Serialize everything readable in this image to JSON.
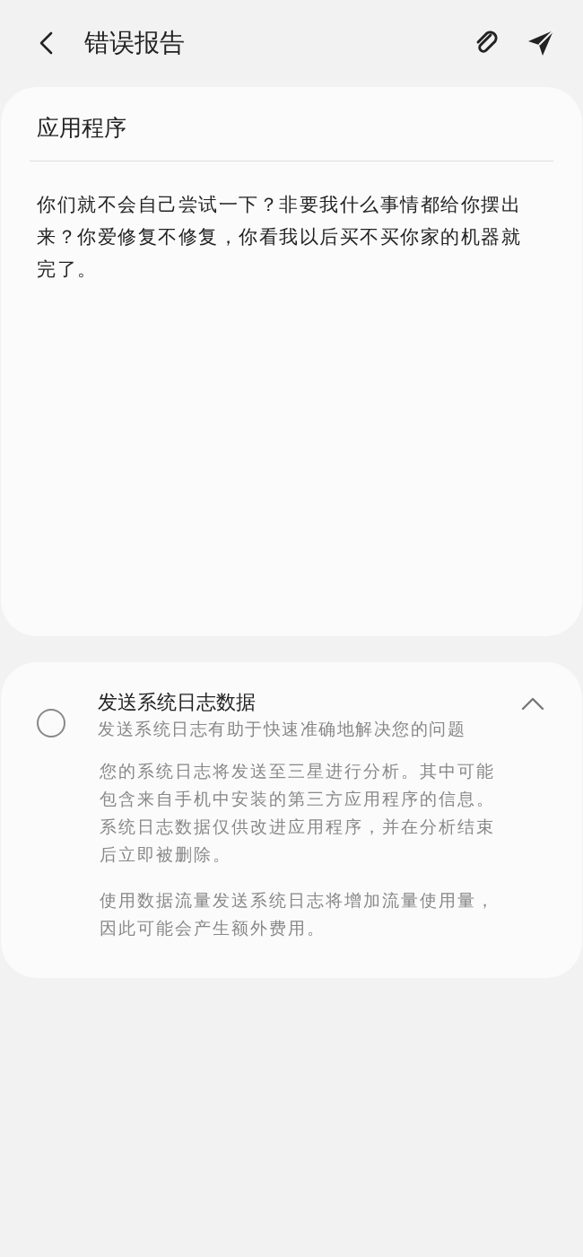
{
  "header": {
    "title": "错误报告"
  },
  "report": {
    "category": "应用程序",
    "message": "你们就不会自己尝试一下？非要我什么事情都给你摆出来？你爱修复不修复，你看我以后买不买你家的机器就完了。"
  },
  "log_option": {
    "title": "发送系统日志数据",
    "subtitle": "发送系统日志有助于快速准确地解决您的问题",
    "checked": false,
    "expanded": true,
    "details": [
      "您的系统日志将发送至三星进行分析。其中可能包含来自手机中安装的第三方应用程序的信息。系统日志数据仅供改进应用程序，并在分析结束后立即被删除。",
      "使用数据流量发送系统日志将增加流量使用量，因此可能会产生额外费用。"
    ]
  }
}
